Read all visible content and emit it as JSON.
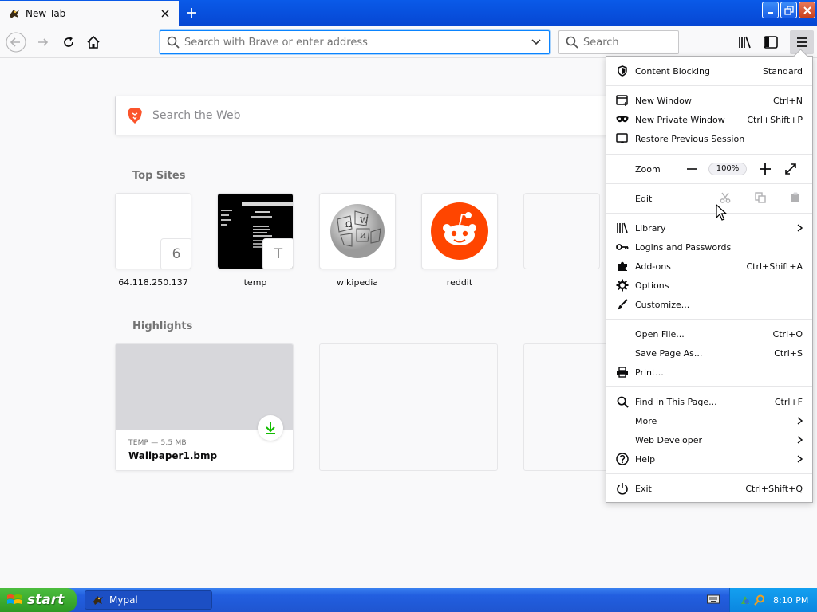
{
  "tab": {
    "title": "New Tab",
    "favicon": "mypal-bird-icon"
  },
  "navbar": {
    "url_placeholder": "Search with Brave or enter address",
    "search_placeholder": "Search"
  },
  "newtab": {
    "websearch_placeholder": "Search the Web",
    "top_sites_title": "Top Sites",
    "top_sites": [
      {
        "label": "64.118.250.137",
        "letter": "6"
      },
      {
        "label": "temp",
        "letter": "T"
      },
      {
        "label": "wikipedia"
      },
      {
        "label": "reddit"
      }
    ],
    "highlights_title": "Highlights",
    "highlights": [
      {
        "meta": "TEMP — 5.5 MB",
        "name": "Wallpaper1.bmp"
      }
    ]
  },
  "menu": {
    "content_blocking": {
      "label": "Content Blocking",
      "value": "Standard"
    },
    "new_window": {
      "label": "New Window",
      "shortcut": "Ctrl+N"
    },
    "new_private": {
      "label": "New Private Window",
      "shortcut": "Ctrl+Shift+P"
    },
    "restore": {
      "label": "Restore Previous Session"
    },
    "zoom": {
      "label": "Zoom",
      "value": "100%"
    },
    "edit": {
      "label": "Edit"
    },
    "library": {
      "label": "Library"
    },
    "logins": {
      "label": "Logins and Passwords"
    },
    "addons": {
      "label": "Add-ons",
      "shortcut": "Ctrl+Shift+A"
    },
    "options": {
      "label": "Options"
    },
    "customize": {
      "label": "Customize..."
    },
    "open_file": {
      "label": "Open File...",
      "shortcut": "Ctrl+O"
    },
    "save_page": {
      "label": "Save Page As...",
      "shortcut": "Ctrl+S"
    },
    "print": {
      "label": "Print..."
    },
    "find": {
      "label": "Find in This Page...",
      "shortcut": "Ctrl+F"
    },
    "more": {
      "label": "More"
    },
    "web_dev": {
      "label": "Web Developer"
    },
    "help": {
      "label": "Help"
    },
    "exit": {
      "label": "Exit",
      "shortcut": "Ctrl+Shift+Q"
    }
  },
  "taskbar": {
    "start_label": "start",
    "task_label": "Mypal",
    "clock": "8:10 PM"
  },
  "colors": {
    "accent": "#0a84ff",
    "reddit": "#ff4500",
    "titlebar": "#0a46d8",
    "start": "#3aa92e"
  }
}
